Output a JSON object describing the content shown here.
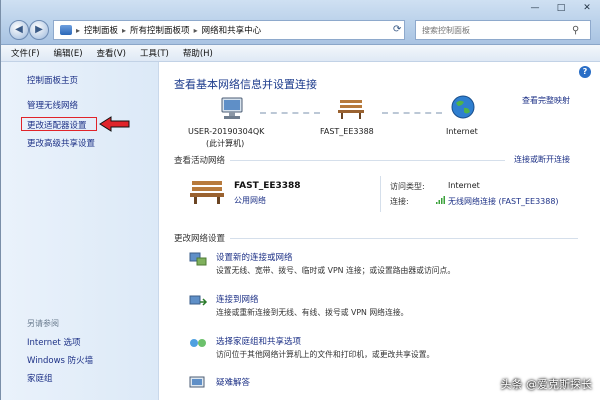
{
  "window": {
    "controls": [
      "—",
      "□",
      "✕"
    ]
  },
  "address_bar": {
    "crumbs": [
      "控制面板",
      "所有控制面板项",
      "网络和共享中心"
    ],
    "search_placeholder": "搜索控制面板"
  },
  "menu": [
    "文件(F)",
    "编辑(E)",
    "查看(V)",
    "工具(T)",
    "帮助(H)"
  ],
  "sidebar": {
    "home": "控制面板主页",
    "items": [
      "管理无线网络",
      "更改适配器设置",
      "更改高级共享设置"
    ],
    "see_also_header": "另请参阅",
    "see_also": [
      "Internet 选项",
      "Windows 防火墙",
      "家庭组"
    ]
  },
  "main": {
    "title": "查看基本网络信息并设置连接",
    "view_full_map": "查看完整映射",
    "map_nodes": [
      {
        "label": "USER-20190304QK",
        "sub": "(此计算机)",
        "icon": "computer-icon"
      },
      {
        "label": "FAST_EE3388",
        "sub": "",
        "icon": "bench-network-icon"
      },
      {
        "label": "Internet",
        "sub": "",
        "icon": "globe-icon"
      }
    ],
    "active_networks_header": "查看活动网络",
    "connect_disconnect": "连接或断开连接",
    "active_network": {
      "name": "FAST_EE3388",
      "type": "公用网络",
      "access_type_label": "访问类型:",
      "access_type_value": "Internet",
      "connection_label": "连接:",
      "connection_value": "无线网络连接 (FAST_EE3388)"
    },
    "change_settings_header": "更改网络设置",
    "tasks": [
      {
        "title": "设置新的连接或网络",
        "desc": "设置无线、宽带、拨号、临时或 VPN 连接；或设置路由器或访问点。",
        "icon": "new-connection-icon"
      },
      {
        "title": "连接到网络",
        "desc": "连接或重新连接到无线、有线、拨号或 VPN 网络连接。",
        "icon": "connect-network-icon"
      },
      {
        "title": "选择家庭组和共享选项",
        "desc": "访问位于其他网络计算机上的文件和打印机，或更改共享设置。",
        "icon": "homegroup-icon"
      },
      {
        "title": "疑难解答",
        "desc": "",
        "icon": "troubleshoot-icon"
      }
    ]
  },
  "watermark": "头条 @爱克斯探长",
  "colors": {
    "link": "#1e3287",
    "title": "#1c3b8c",
    "highlight": "#e0242a"
  }
}
